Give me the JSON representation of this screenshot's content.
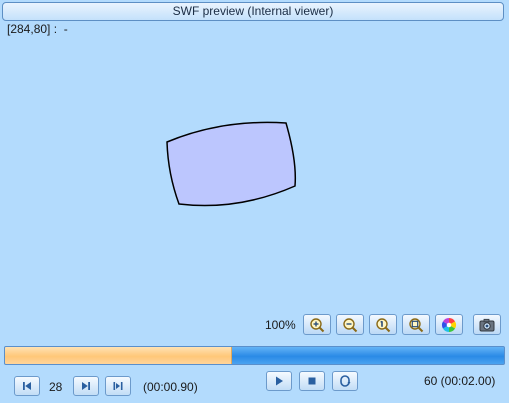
{
  "window": {
    "title": "SWF preview (Internal viewer)"
  },
  "readout": {
    "coordinates": "[284,80] :",
    "object": "-"
  },
  "stage": {
    "shape_fill": "#bcc6fe",
    "shape_stroke": "#000000"
  },
  "toolbar": {
    "zoom_label": "100%",
    "buttons": [
      "zoom-in-icon",
      "zoom-out-icon",
      "zoom-actual-size-icon",
      "zoom-fit-icon",
      "color-wheel-icon",
      "camera-icon"
    ]
  },
  "playback": {
    "progress_fraction": 0.455,
    "current_frame": "28",
    "current_time": "(00:00.90)",
    "total_frames_time": "60 (00:02.00)"
  },
  "colors": {
    "background": "#b3dbfd",
    "progress_played": "#ffc778",
    "progress_remaining": "#2a8ae6"
  }
}
